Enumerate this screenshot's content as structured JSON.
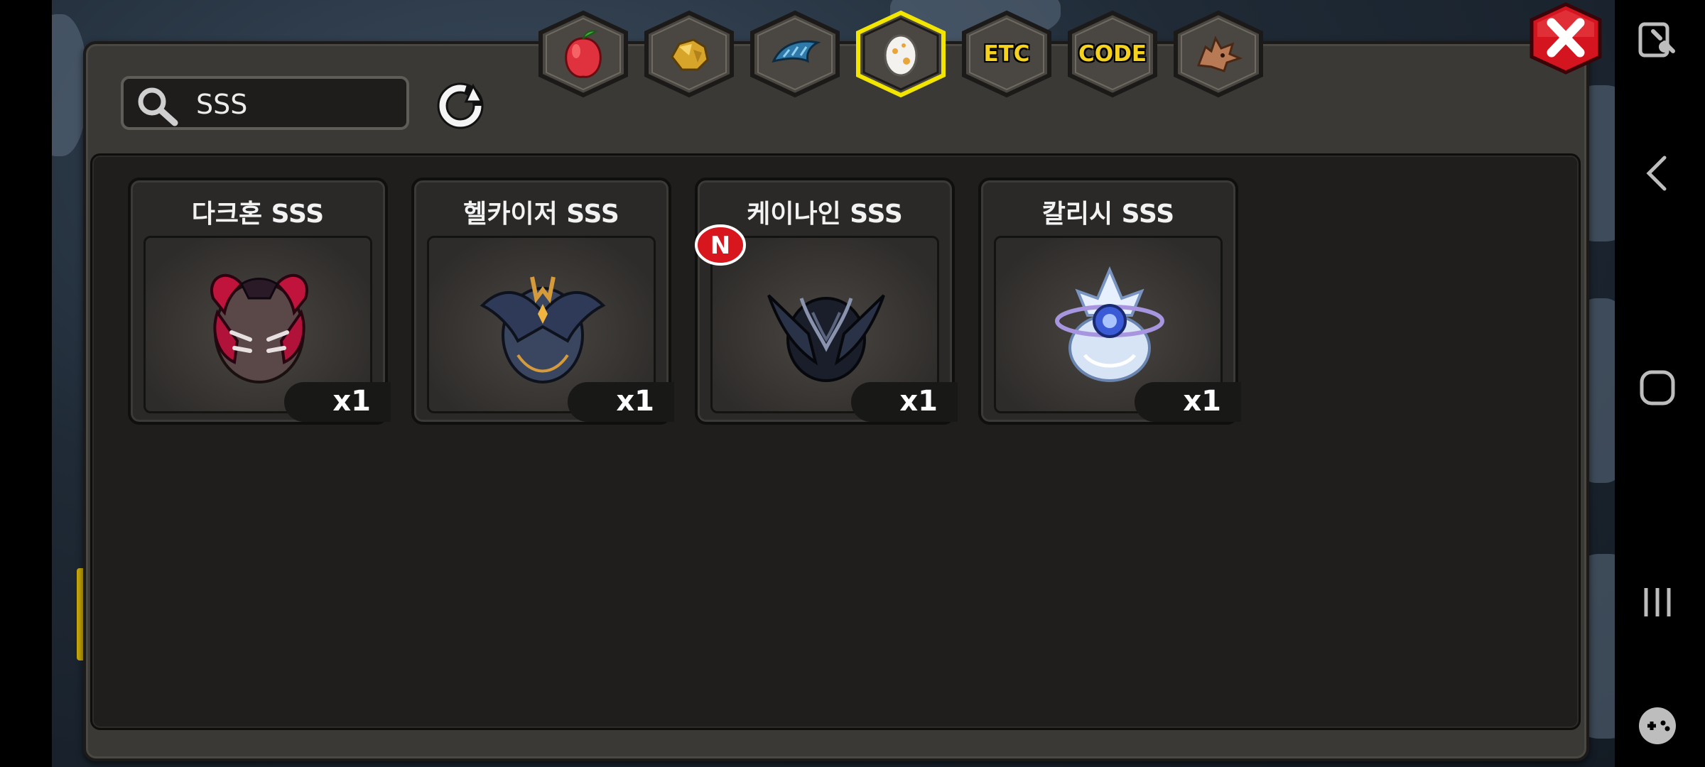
{
  "search": {
    "value": "SSS",
    "icon": "search-icon"
  },
  "tabs": [
    {
      "id": "fruit",
      "icon": "fruit-icon",
      "label": ""
    },
    {
      "id": "ore",
      "icon": "gold-ore-icon",
      "label": ""
    },
    {
      "id": "claw",
      "icon": "claw-icon",
      "label": ""
    },
    {
      "id": "egg",
      "icon": "egg-icon",
      "label": "",
      "selected": true
    },
    {
      "id": "etc",
      "icon": "",
      "label": "ETC"
    },
    {
      "id": "code",
      "icon": "",
      "label": "CODE"
    },
    {
      "id": "dragon",
      "icon": "dragon-head-icon",
      "label": ""
    }
  ],
  "items": [
    {
      "name": "다크혼 SSS",
      "qty": "x1",
      "icon": "dark-horn-egg-icon",
      "is_new": false
    },
    {
      "name": "헬카이저 SSS",
      "qty": "x1",
      "icon": "hellkaiser-egg-icon",
      "is_new": false
    },
    {
      "name": "케이나인 SSS",
      "qty": "x1",
      "icon": "canine-egg-icon",
      "is_new": true,
      "badge": "N"
    },
    {
      "name": "칼리시 SSS",
      "qty": "x1",
      "icon": "kalish-egg-icon",
      "is_new": false
    }
  ],
  "colors": {
    "tab_text": "#f5d21f",
    "selected_tab_border": "#f2e600",
    "close_button": "#d4141e",
    "new_badge": "#d8161d"
  }
}
